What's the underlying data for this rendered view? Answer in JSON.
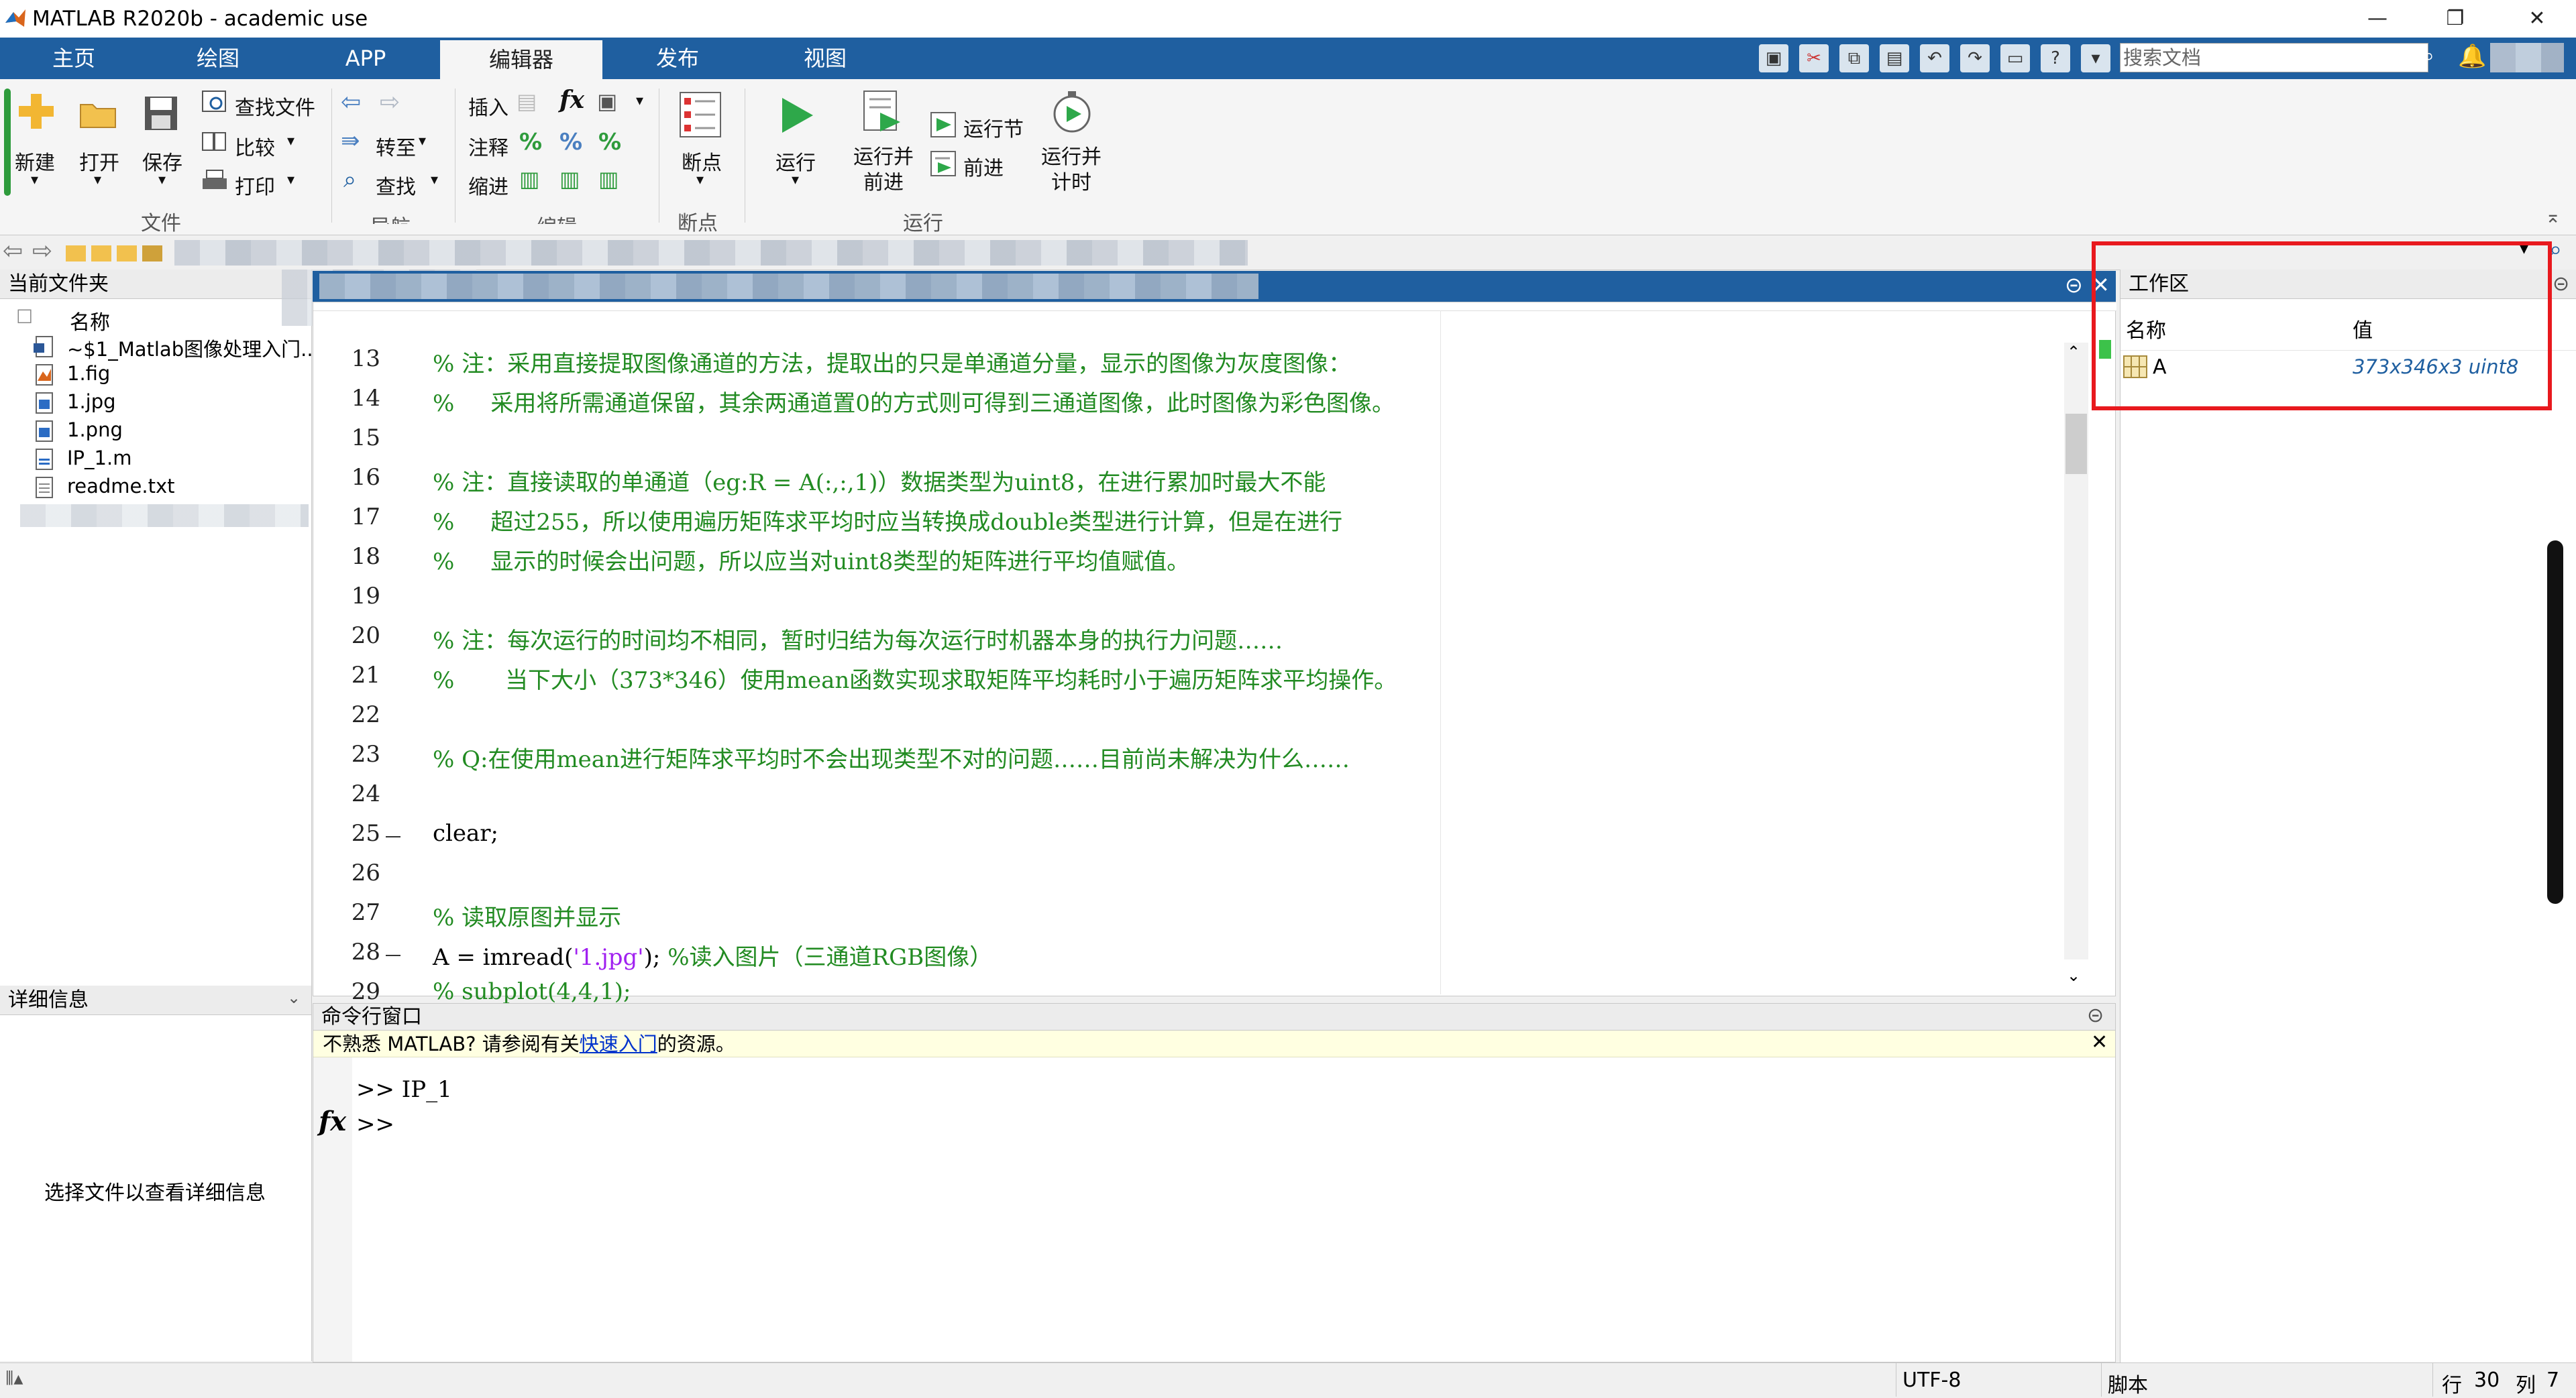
{
  "window": {
    "title": "MATLAB R2020b - academic use",
    "minimize": "—",
    "restore": "❐",
    "close": "✕"
  },
  "tabs": [
    "主页",
    "绘图",
    "APP",
    "编辑器",
    "发布",
    "视图"
  ],
  "active_tab": "编辑器",
  "quick_access": {
    "search_placeholder": "搜索文档"
  },
  "ribbon": {
    "file": {
      "new": "新建",
      "open": "打开",
      "save": "保存",
      "find_files": "查找文件",
      "compare": "比较",
      "print": "打印",
      "group": "文件"
    },
    "navigate": {
      "goto": "转至",
      "find": "查找",
      "group": "导航"
    },
    "edit": {
      "insert": "插入",
      "comment": "注释",
      "indent": "缩进",
      "fx": "fx",
      "group": "编辑"
    },
    "breakpoints": {
      "label": "断点",
      "group": "断点"
    },
    "run": {
      "run": "运行",
      "run_advance": "运行并\n前进",
      "run_section": "运行节",
      "advance": "前进",
      "run_time": "运行并\n计时",
      "group": "运行"
    }
  },
  "file_panel": {
    "title": "当前文件夹",
    "column": "名称",
    "files": [
      "~$1_Matlab图像处理入门...",
      "1.fig",
      "1.jpg",
      "1.png",
      "IP_1.m",
      "readme.txt"
    ]
  },
  "detail_panel": {
    "title": "详细信息",
    "message": "选择文件以查看详细信息"
  },
  "editor": {
    "lines": [
      {
        "n": "13",
        "text": "% 注：采用直接提取图像通道的方法，提取出的只是单通道分量，显示的图像为灰度图像："
      },
      {
        "n": "14",
        "text": "%     采用将所需通道保留，其余两通道置0的方式则可得到三通道图像，此时图像为彩色图像。"
      },
      {
        "n": "15",
        "text": ""
      },
      {
        "n": "16",
        "text": "% 注：直接读取的单通道（eg:R = A(:,:,1)）数据类型为uint8，在进行累加时最大不能"
      },
      {
        "n": "17",
        "text": "%     超过255，所以使用遍历矩阵求平均时应当转换成double类型进行计算，但是在进行"
      },
      {
        "n": "18",
        "text": "%     显示的时候会出问题，所以应当对uint8类型的矩阵进行平均值赋值。"
      },
      {
        "n": "19",
        "text": ""
      },
      {
        "n": "20",
        "text": "% 注：每次运行的时间均不相同，暂时归结为每次运行时机器本身的执行力问题……"
      },
      {
        "n": "21",
        "text": "%       当下大小（373*346）使用mean函数实现求取矩阵平均耗时小于遍历矩阵求平均操作。"
      },
      {
        "n": "22",
        "text": ""
      },
      {
        "n": "23",
        "text": "% Q:在使用mean进行矩阵求平均时不会出现类型不对的问题……目前尚未解决为什么……"
      },
      {
        "n": "24",
        "text": ""
      },
      {
        "n": "25",
        "text": "clear;"
      },
      {
        "n": "26",
        "text": ""
      },
      {
        "n": "27",
        "text": "% 读取原图并显示"
      },
      {
        "n": "28",
        "text": "A = imread('1.jpg'); %读入图片（三通道RGB图像）"
      },
      {
        "n": "29",
        "text": "% subplot(4,4,1);"
      }
    ],
    "line28_parts": {
      "a": "A = imread(",
      "b": "'1.jpg'",
      "c": "); ",
      "d": "%读入图片（三通道RGB图像）"
    }
  },
  "command_window": {
    "title": "命令行窗口",
    "notice_prefix": "不熟悉 MATLAB? 请参阅有关",
    "notice_link": "快速入门",
    "notice_suffix": "的资源。",
    "history": ">> IP_1",
    "prompt": ">>",
    "fx": "fx"
  },
  "workspace": {
    "title": "工作区",
    "col_name": "名称",
    "col_value": "值",
    "var_name": "A",
    "var_value": "373x346x3 uint8"
  },
  "status": {
    "encoding": "UTF-8",
    "type": "脚本",
    "row_label": "行",
    "row": "30",
    "col_label": "列",
    "col": "7"
  },
  "colors": {
    "tab_blue": "#1f5fa0",
    "comment_green": "#228b22",
    "string_purple": "#a020f0",
    "highlight_red": "#e8191e"
  }
}
